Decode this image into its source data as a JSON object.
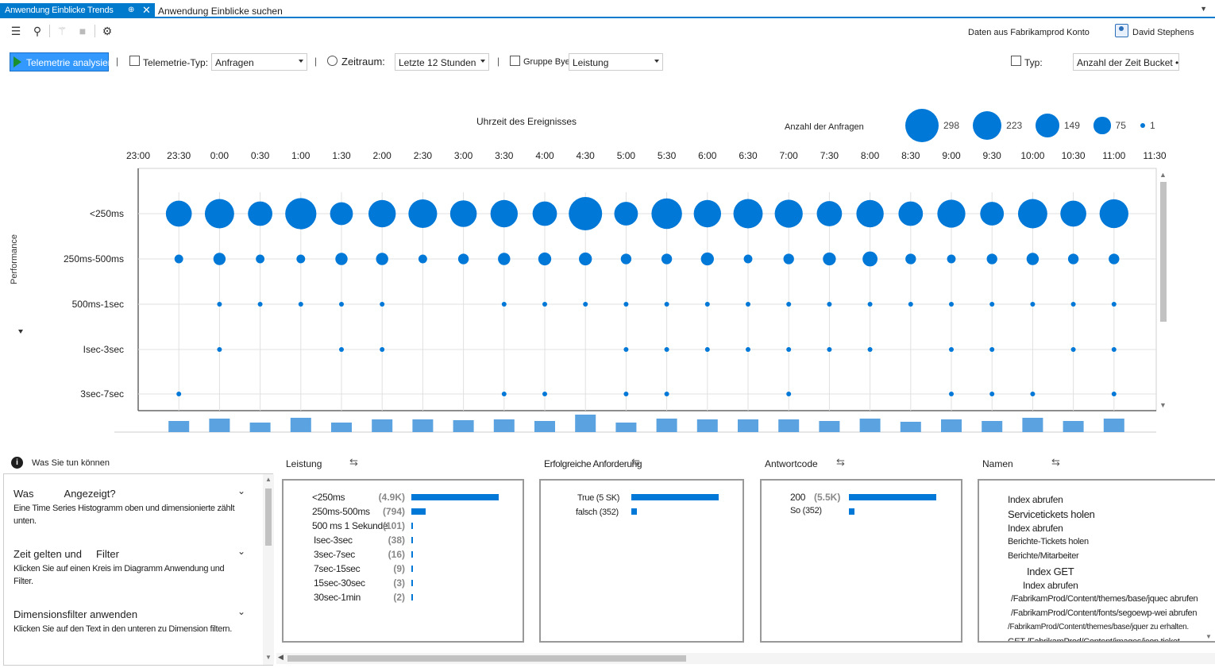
{
  "tabs": {
    "active_label": "Anwendung Einblicke Trends",
    "pin_glyph": "⊕",
    "close_glyph": "✕",
    "inactive_label": "Anwendung Einblicke suchen"
  },
  "toolbar": {
    "account_label": "Daten aus Fabrikamprod Konto",
    "user_name": "David Stephens"
  },
  "filters": {
    "analyze_label": "Telemetrie analysieren",
    "telemetry_type_label": "Telemetrie-Typ:",
    "telemetry_type_value": "Anfragen",
    "period_label": "Zeitraum:",
    "period_value": "Letzte 12 Stunden",
    "group_by_label": "Gruppe Bye",
    "group_by_value": "Leistung",
    "type_label": "Typ:",
    "type_value": "Anzahl der Zeit Bucket •"
  },
  "chart": {
    "title": "Uhrzeit des Ereignisses",
    "y_axis_group_label": "Performance",
    "legend_title": "Anzahl der Anfragen",
    "legend": [
      298,
      223,
      149,
      75,
      1
    ],
    "color": "#0078d7"
  },
  "chart_data": {
    "type": "scatter",
    "title": "Uhrzeit des Ereignisses",
    "x_ticks": [
      "23:00",
      "23:30",
      "0:00",
      "0:30",
      "1:00",
      "1:30",
      "2:00",
      "2:30",
      "3:00",
      "3:30",
      "4:00",
      "4:30",
      "5:00",
      "5:30",
      "6:00",
      "6:30",
      "7:00",
      "7:30",
      "8:00",
      "8:30",
      "9:00",
      "9:30",
      "10:00",
      "10:30",
      "11:00",
      "11:30"
    ],
    "categories": [
      "<250ms",
      "250ms-500ms",
      "500ms-1sec",
      "Isec-3sec",
      "3sec-7sec"
    ],
    "series": [
      {
        "name": "<250ms",
        "values": [
          null,
          180,
          230,
          160,
          260,
          140,
          200,
          220,
          190,
          200,
          160,
          298,
          150,
          250,
          200,
          230,
          210,
          170,
          200,
          160,
          210,
          150,
          230,
          180,
          223,
          null
        ]
      },
      {
        "name": "250ms-500ms",
        "values": [
          null,
          20,
          40,
          20,
          20,
          40,
          40,
          20,
          30,
          40,
          45,
          45,
          30,
          30,
          45,
          20,
          30,
          45,
          60,
          30,
          20,
          30,
          40,
          30,
          30,
          null
        ]
      },
      {
        "name": "500ms-1sec",
        "values": [
          null,
          null,
          5,
          5,
          5,
          5,
          5,
          null,
          null,
          5,
          5,
          5,
          5,
          5,
          5,
          5,
          5,
          5,
          5,
          5,
          5,
          5,
          5,
          5,
          5,
          null
        ]
      },
      {
        "name": "Isec-3sec",
        "values": [
          null,
          null,
          5,
          null,
          null,
          5,
          5,
          null,
          null,
          null,
          null,
          null,
          5,
          5,
          5,
          5,
          5,
          5,
          5,
          null,
          5,
          5,
          null,
          5,
          5,
          null
        ]
      },
      {
        "name": "3sec-7sec",
        "values": [
          null,
          5,
          null,
          null,
          null,
          null,
          null,
          null,
          null,
          5,
          5,
          null,
          5,
          5,
          null,
          null,
          5,
          null,
          null,
          null,
          5,
          5,
          5,
          null,
          5,
          null
        ]
      }
    ],
    "histogram": [
      null,
      14,
      17,
      12,
      18,
      12,
      16,
      16,
      15,
      16,
      14,
      22,
      12,
      17,
      16,
      16,
      16,
      14,
      17,
      13,
      16,
      14,
      18,
      14,
      17,
      null
    ]
  },
  "help": {
    "header": "Was Sie tun können",
    "items": [
      {
        "title_a": "Was",
        "title_b": "Angezeigt?",
        "text": "Eine Time Series Histogramm oben und dimensionierte zählt unten."
      },
      {
        "title_a": "Zeit gelten und",
        "title_b": "Filter",
        "text": "Klicken Sie auf einen Kreis im Diagramm Anwendung und Filter."
      },
      {
        "title_a": "Dimensionsfilter anwenden",
        "title_b": "",
        "text": "Klicken Sie auf den Text in den unteren zu Dimension filtern."
      }
    ]
  },
  "dimensions": {
    "performance": {
      "title": "Leistung",
      "rows": [
        {
          "label": "<250ms",
          "count": "(4.9K)",
          "value": 4900
        },
        {
          "label": "250ms-500ms",
          "count": "(794)",
          "value": 794
        },
        {
          "label": "500 ms 1 Sekunde",
          "count": "(101)",
          "value": 101
        },
        {
          "label": "Isec-3sec",
          "count": "(38)",
          "value": 38
        },
        {
          "label": "3sec-7sec",
          "count": "(16)",
          "value": 16
        },
        {
          "label": "7sec-15sec",
          "count": "(9)",
          "value": 9
        },
        {
          "label": "15sec-30sec",
          "count": "(3)",
          "value": 3
        },
        {
          "label": "30sec-1min",
          "count": "(2)",
          "value": 2
        }
      ]
    },
    "success": {
      "title": "Erfolgreiche Anforderung",
      "rows": [
        {
          "label": "True (5 SK)",
          "value": 5500
        },
        {
          "label": "falsch (352)",
          "value": 352
        }
      ]
    },
    "response_code": {
      "title": "Antwortcode",
      "rows": [
        {
          "label": "200",
          "count": "(5.5K)",
          "value": 5500
        },
        {
          "label": "So (352)",
          "count": "",
          "value": 352
        }
      ]
    },
    "names": {
      "title": "Namen",
      "items": [
        "Index abrufen",
        "Servicetickets holen",
        "Index abrufen",
        "Berichte-Tickets holen",
        "Berichte/Mitarbeiter",
        "Index GET",
        "Index abrufen",
        "/FabrikamProd/Content/themes/base/jquec abrufen",
        "/FabrikamProd/Content/fonts/segoewp-wei abrufen",
        "/FabrikamProd/Content/themes/base/jquer zu erhalten.",
        "GET /FabrikamProd/Content/images/icon ticket"
      ]
    }
  }
}
